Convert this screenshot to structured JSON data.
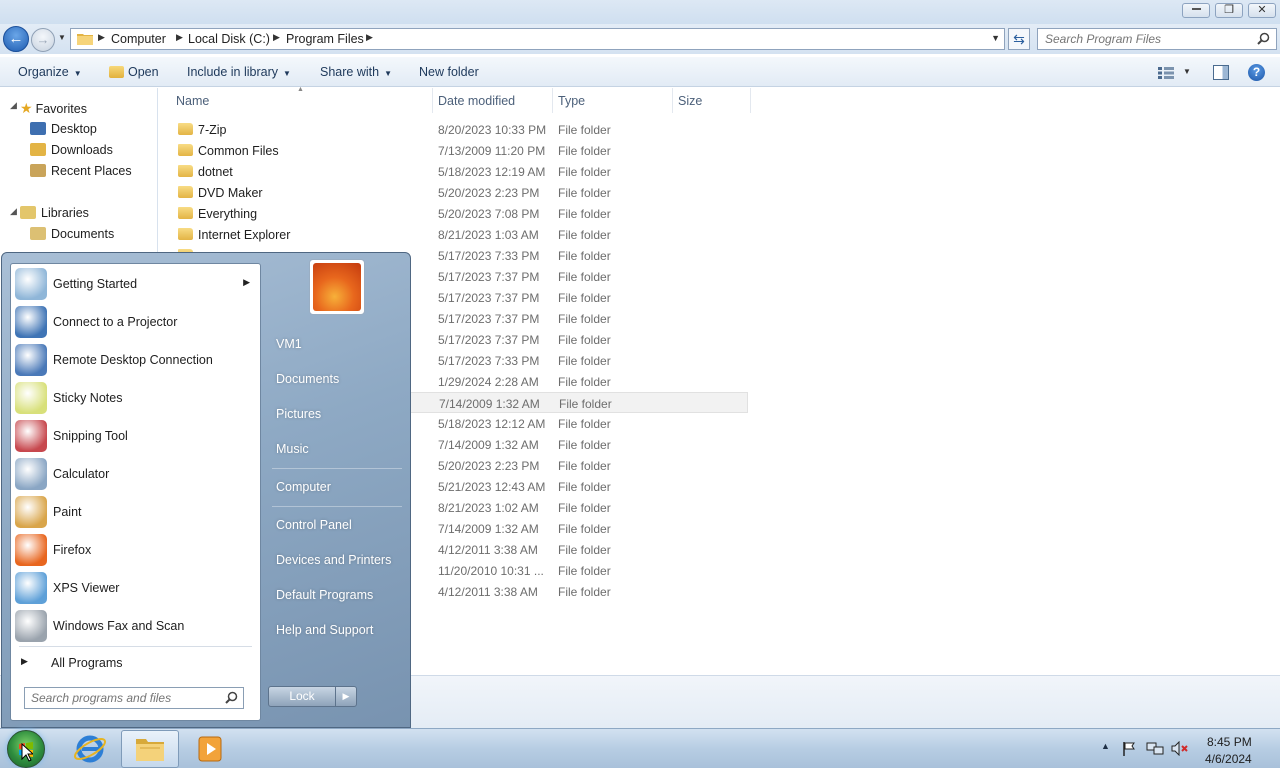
{
  "window": {
    "breadcrumb": [
      "Computer",
      "Local Disk (C:)",
      "Program Files"
    ],
    "search_placeholder": "Search Program Files"
  },
  "toolbar": {
    "organize": "Organize",
    "open": "Open",
    "include_in_library": "Include in library",
    "share_with": "Share with",
    "new_folder": "New folder"
  },
  "nav": {
    "favorites": "Favorites",
    "desktop": "Desktop",
    "downloads": "Downloads",
    "recent_places": "Recent Places",
    "libraries": "Libraries",
    "documents": "Documents"
  },
  "columns": {
    "name": "Name",
    "date_modified": "Date modified",
    "type": "Type",
    "size": "Size"
  },
  "files": [
    {
      "name": "7-Zip",
      "date": "8/20/2023 10:33 PM",
      "type": "File folder"
    },
    {
      "name": "Common Files",
      "date": "7/13/2009 11:20 PM",
      "type": "File folder"
    },
    {
      "name": "dotnet",
      "date": "5/18/2023 12:19 AM",
      "type": "File folder"
    },
    {
      "name": "DVD Maker",
      "date": "5/20/2023 2:23 PM",
      "type": "File folder"
    },
    {
      "name": "Everything",
      "date": "5/20/2023 7:08 PM",
      "type": "File folder"
    },
    {
      "name": "Internet Explorer",
      "date": "8/21/2023 1:03 AM",
      "type": "File folder"
    },
    {
      "name": "",
      "date": "5/17/2023 7:33 PM",
      "type": "File folder"
    },
    {
      "name": "",
      "date": "5/17/2023 7:37 PM",
      "type": "File folder"
    },
    {
      "name": "",
      "date": "5/17/2023 7:37 PM",
      "type": "File folder"
    },
    {
      "name": "",
      "date": "5/17/2023 7:37 PM",
      "type": "File folder"
    },
    {
      "name": "",
      "date": "5/17/2023 7:37 PM",
      "type": "File folder"
    },
    {
      "name": "",
      "date": "5/17/2023 7:33 PM",
      "type": "File folder"
    },
    {
      "name": "",
      "date": "1/29/2024 2:28 AM",
      "type": "File folder"
    },
    {
      "name": "",
      "date": "7/14/2009 1:32 AM",
      "type": "File folder"
    },
    {
      "name": "",
      "date": "5/18/2023 12:12 AM",
      "type": "File folder"
    },
    {
      "name": "",
      "date": "7/14/2009 1:32 AM",
      "type": "File folder"
    },
    {
      "name": "",
      "date": "5/20/2023 2:23 PM",
      "type": "File folder"
    },
    {
      "name": "",
      "date": "5/21/2023 12:43 AM",
      "type": "File folder"
    },
    {
      "name": "",
      "date": "8/21/2023 1:02 AM",
      "type": "File folder"
    },
    {
      "name": "",
      "date": "7/14/2009 1:32 AM",
      "type": "File folder"
    },
    {
      "name": "",
      "date": "4/12/2011 3:38 AM",
      "type": "File folder"
    },
    {
      "name": "",
      "date": "11/20/2010 10:31 ...",
      "type": "File folder"
    },
    {
      "name": "",
      "date": "4/12/2011 3:38 AM",
      "type": "File folder"
    }
  ],
  "start_menu": {
    "programs": [
      {
        "label": "Getting Started",
        "icon": "getting-started-icon",
        "color": "#8fb6d8",
        "has_submenu": true
      },
      {
        "label": "Connect to a Projector",
        "icon": "projector-icon",
        "color": "#3f74b5"
      },
      {
        "label": "Remote Desktop Connection",
        "icon": "remote-desktop-icon",
        "color": "#4a79b8"
      },
      {
        "label": "Sticky Notes",
        "icon": "sticky-notes-icon",
        "color": "#d8e07a"
      },
      {
        "label": "Snipping Tool",
        "icon": "snipping-tool-icon",
        "color": "#c7484e"
      },
      {
        "label": "Calculator",
        "icon": "calculator-icon",
        "color": "#8aa6c4"
      },
      {
        "label": "Paint",
        "icon": "paint-icon",
        "color": "#d9a54a"
      },
      {
        "label": "Firefox",
        "icon": "firefox-icon",
        "color": "#e8661f"
      },
      {
        "label": "XPS Viewer",
        "icon": "xps-viewer-icon",
        "color": "#5ea0d8"
      },
      {
        "label": "Windows Fax and Scan",
        "icon": "fax-scan-icon",
        "color": "#9aa3ad"
      }
    ],
    "all_programs": "All Programs",
    "search_placeholder": "Search programs and files",
    "right_links": [
      "VM1",
      "Documents",
      "Pictures",
      "Music",
      "Computer",
      "Control Panel",
      "Devices and Printers",
      "Default Programs",
      "Help and Support"
    ],
    "lock": "Lock"
  },
  "taskbar": {
    "time": "8:45 PM",
    "date": "4/6/2024"
  }
}
